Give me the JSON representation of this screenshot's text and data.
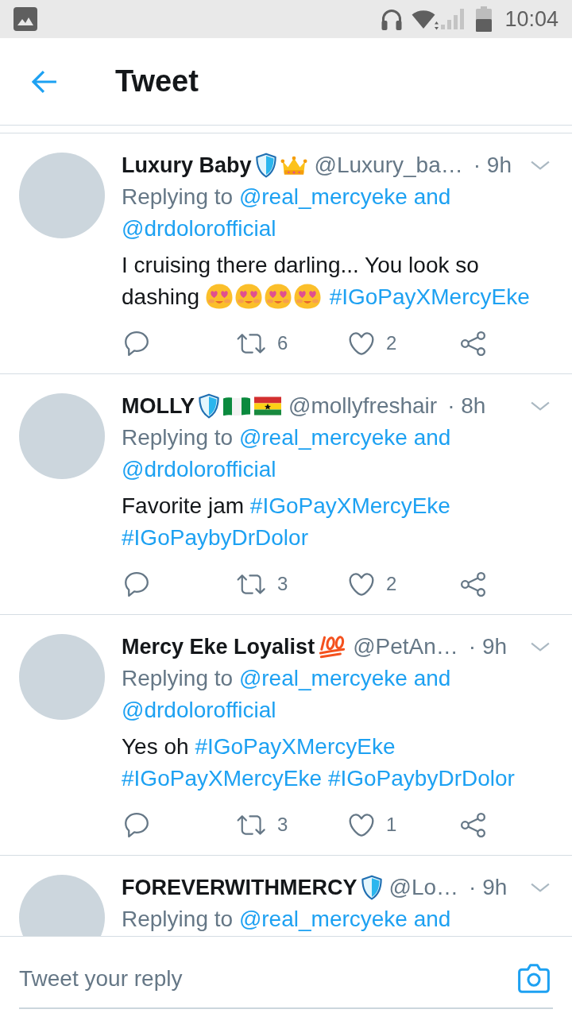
{
  "status_bar": {
    "time": "10:04"
  },
  "header": {
    "title": "Tweet"
  },
  "tweets": [
    {
      "name": "Luxury Baby",
      "badges": [
        {
          "kind": "shield"
        },
        {
          "kind": "crown"
        }
      ],
      "handle": "@Luxury_ba…",
      "time": "· 9h",
      "reply": {
        "label": "Replying to",
        "links": [
          "@real_mercyeke and",
          "@drdolorofficial"
        ]
      },
      "body": [
        {
          "kind": "text",
          "text": "I cruising there darling... You look so dashing"
        },
        {
          "kind": "heart_eyes"
        },
        {
          "kind": "heart_eyes"
        },
        {
          "kind": "heart_eyes"
        },
        {
          "kind": "heart_eyes"
        },
        {
          "kind": "hashtag",
          "text": "#IGoPayXMercyEke"
        }
      ],
      "actions": {
        "retweets": "6",
        "retweeted": false,
        "likes": "2",
        "liked": false
      }
    },
    {
      "name": "MOLLY",
      "badges": [
        {
          "kind": "shield"
        },
        {
          "kind": "nigeria_flag"
        },
        {
          "kind": "ghana_flag"
        }
      ],
      "handle": "@mollyfreshair",
      "time": "· 8h",
      "reply": {
        "label": "Replying to",
        "links": [
          "@real_mercyeke and",
          "@drdolorofficial"
        ]
      },
      "body": [
        {
          "kind": "text",
          "text": "Favorite jam"
        },
        {
          "kind": "hashtag",
          "text": "#IGoPayXMercyEke"
        },
        {
          "kind": "hashtag",
          "text": "#IGoPaybyDrDolor"
        }
      ],
      "actions": {
        "retweets": "3",
        "retweeted": false,
        "likes": "2",
        "liked": false
      }
    },
    {
      "name": "Mercy Eke Loyalist",
      "badges": [
        {
          "kind": "hundred_points"
        }
      ],
      "handle": "@PetAn…",
      "time": "· 9h",
      "reply": {
        "label": "Replying to",
        "links": [
          "@real_mercyeke and",
          "@drdolorofficial"
        ]
      },
      "body": [
        {
          "kind": "text",
          "text": "Yes oh"
        },
        {
          "kind": "hashtag",
          "text": "#IGoPayXMercyEke"
        },
        {
          "kind": "hashtag",
          "text": "#IGoPayXMercyEke"
        },
        {
          "kind": "hashtag",
          "text": "#IGoPaybyDrDolor"
        }
      ],
      "actions": {
        "retweets": "3",
        "retweeted": false,
        "likes": "1",
        "liked": false
      }
    },
    {
      "name": "FOREVERWITHMERCY",
      "badges": [
        {
          "kind": "shield"
        }
      ],
      "handle": "@Lo…",
      "time": "· 9h",
      "reply": {
        "label": "Replying to",
        "links": [
          "@real_mercyeke and"
        ]
      }
    }
  ],
  "composer": {
    "placeholder": "Tweet your reply"
  }
}
